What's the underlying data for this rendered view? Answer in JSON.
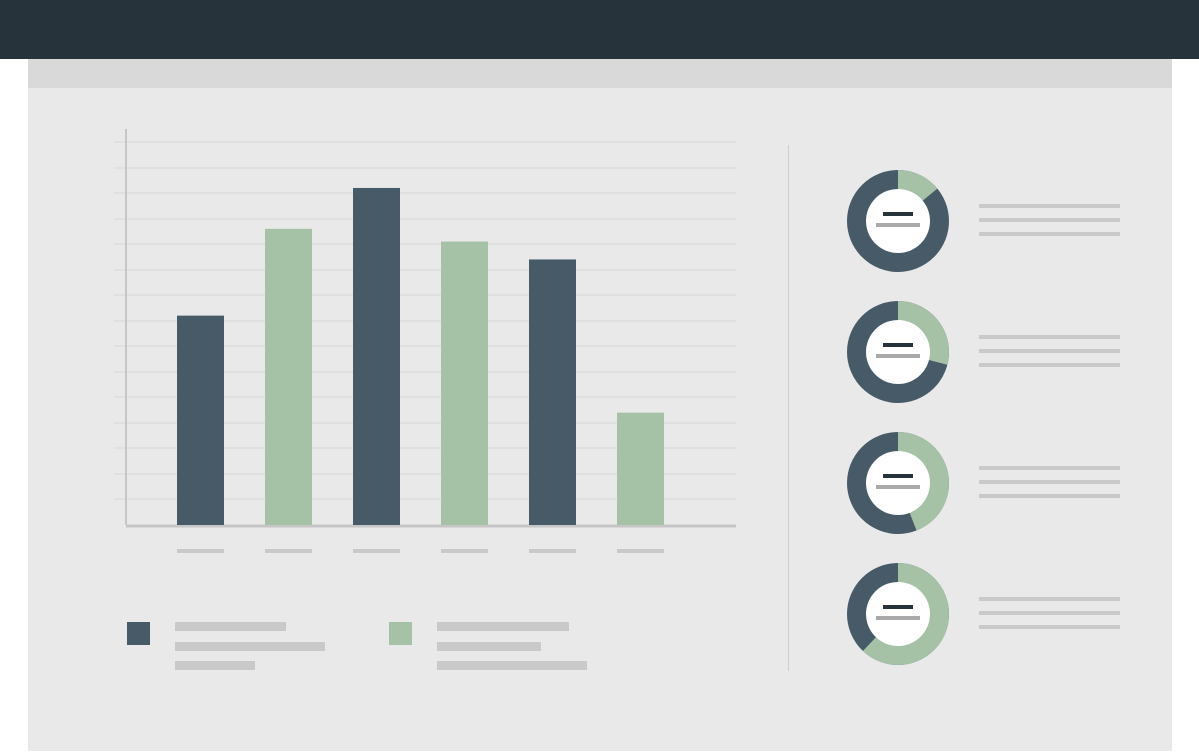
{
  "colors": {
    "header": "#27333b",
    "panel": "#e9e9e9",
    "strip": "#d9d9d9",
    "dark_series": "#465a67",
    "light_series": "#a5c2a7",
    "placeholder": "#c9c9c9",
    "axis": "#c6c6c6",
    "grid": "#d6d6d6"
  },
  "chart_data": {
    "type": "bar",
    "categories": [
      "",
      "",
      "",
      "",
      "",
      ""
    ],
    "series": [
      {
        "color": "#465a67",
        "values": [
          8.2,
          null,
          13.2,
          null,
          10.4,
          null
        ]
      },
      {
        "color": "#a5c2a7",
        "values": [
          null,
          11.6,
          null,
          11.1,
          null,
          4.4
        ]
      }
    ],
    "ylim": [
      0,
      15
    ],
    "grid": true,
    "legend": "bottom-left"
  },
  "donuts": [
    {
      "fraction": 0.14,
      "icon": "placeholder-text-icon"
    },
    {
      "fraction": 0.29,
      "icon": "placeholder-text-icon"
    },
    {
      "fraction": 0.44,
      "icon": "placeholder-text-icon"
    },
    {
      "fraction": 0.62,
      "icon": "placeholder-text-icon"
    }
  ]
}
